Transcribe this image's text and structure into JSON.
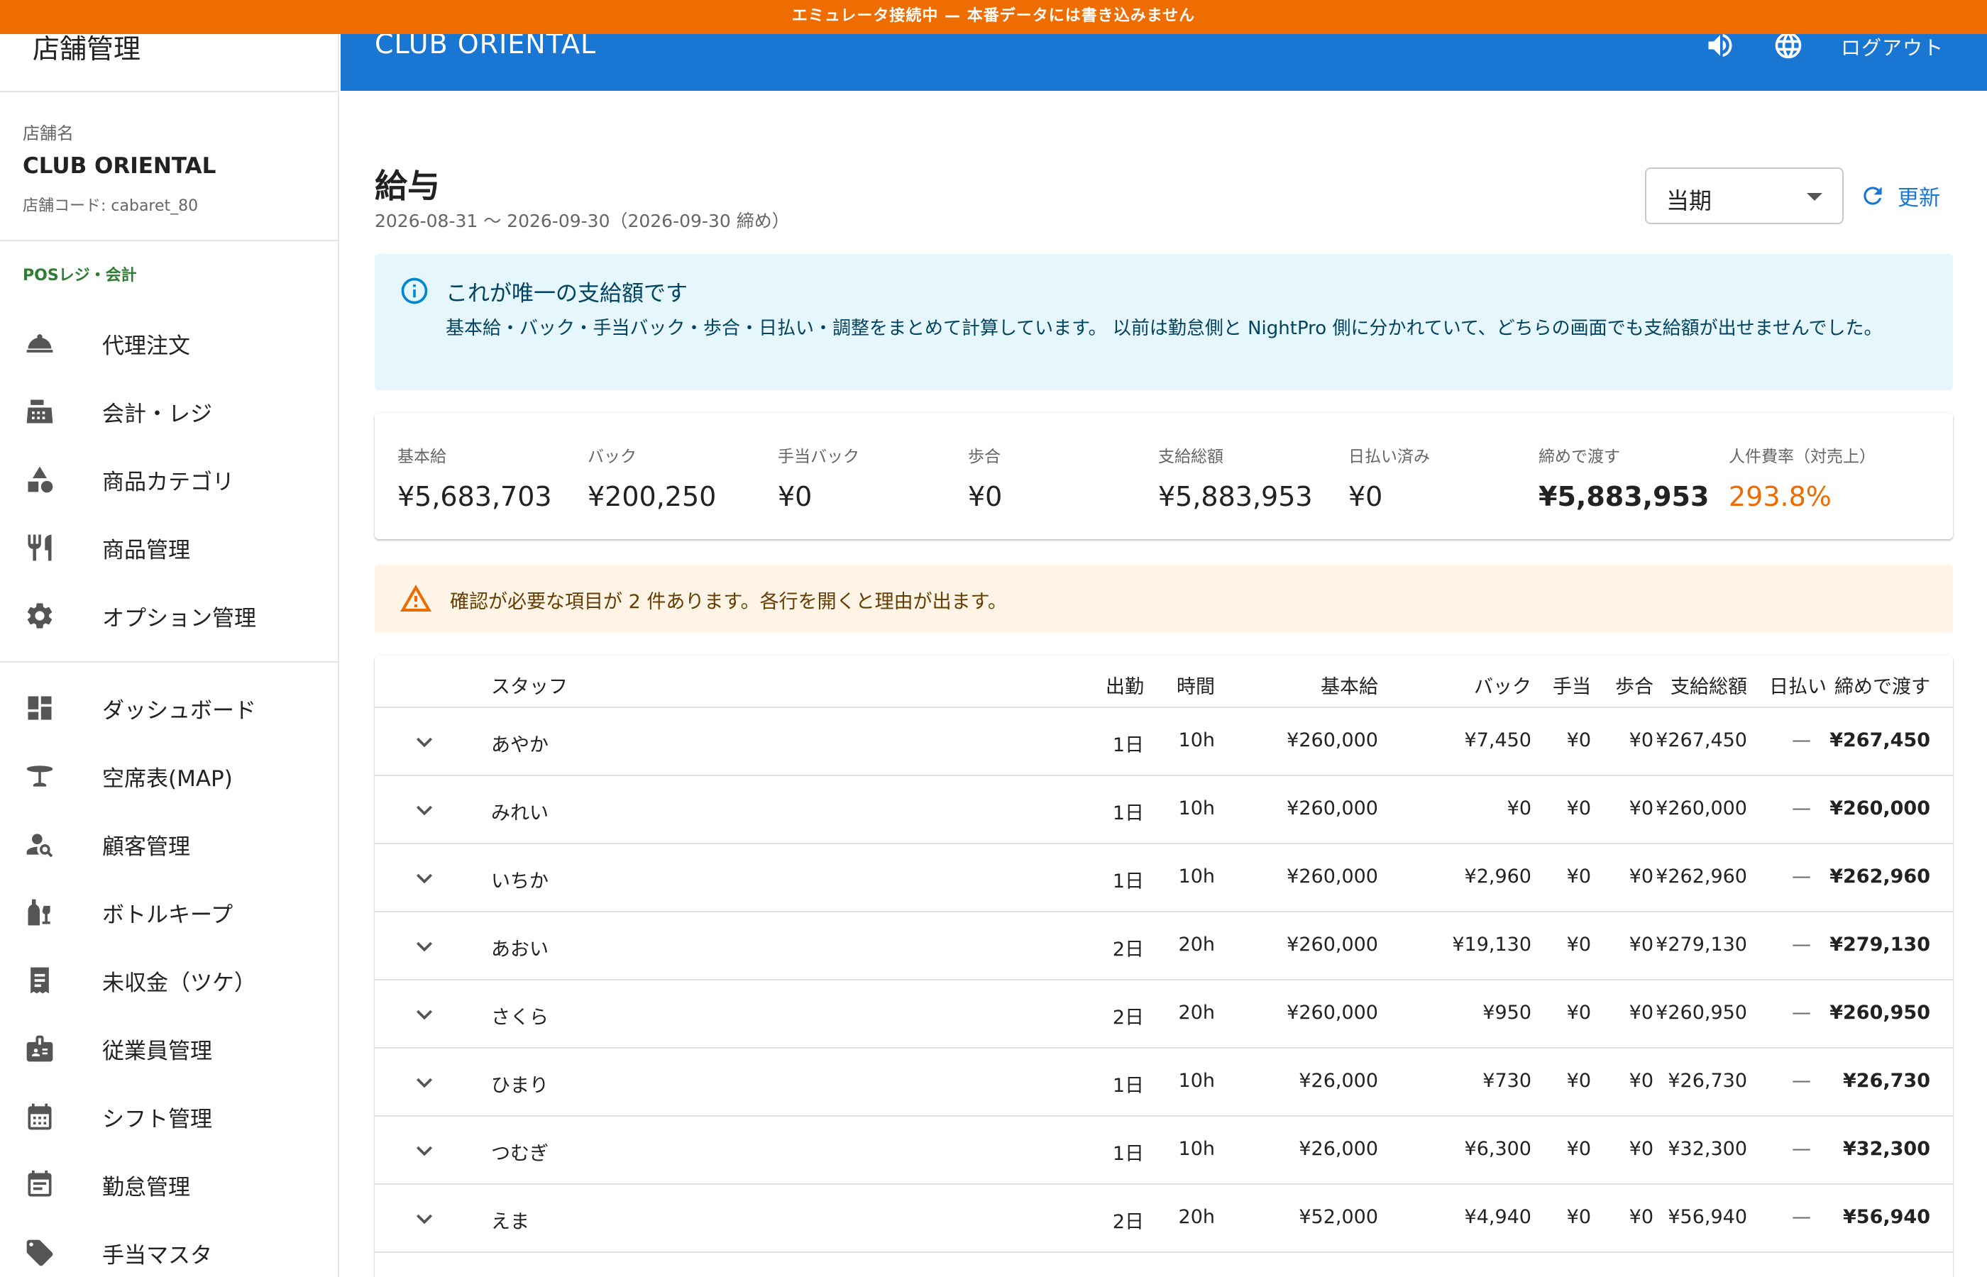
{
  "banner": "エミュレータ接続中 — 本番データには書き込みません",
  "sidebar": {
    "title": "店舗管理",
    "shop_label": "店舗名",
    "shop_name": "CLUB ORIENTAL",
    "shop_code": "店舗コード: cabaret_80",
    "section_pos": "POSレジ・会計",
    "items": [
      {
        "label": "代理注文",
        "icon": "room-service-icon"
      },
      {
        "label": "会計・レジ",
        "icon": "cash-register-icon"
      },
      {
        "label": "商品カテゴリ",
        "icon": "category-icon"
      },
      {
        "label": "商品管理",
        "icon": "restaurant-icon"
      },
      {
        "label": "オプション管理",
        "icon": "gear-icon"
      },
      {
        "label": "ダッシュボード",
        "icon": "dashboard-icon"
      },
      {
        "label": "空席表(MAP)",
        "icon": "table-icon"
      },
      {
        "label": "顧客管理",
        "icon": "person-search-icon"
      },
      {
        "label": "ボトルキープ",
        "icon": "bottle-icon"
      },
      {
        "label": "未収金（ツケ）",
        "icon": "receipt-icon"
      },
      {
        "label": "従業員管理",
        "icon": "badge-icon"
      },
      {
        "label": "シフト管理",
        "icon": "calendar-month-icon"
      },
      {
        "label": "勤怠管理",
        "icon": "event-note-icon"
      },
      {
        "label": "手当マスタ",
        "icon": "tag-icon"
      }
    ]
  },
  "appbar": {
    "title": "CLUB ORIENTAL",
    "logout": "ログアウト"
  },
  "page": {
    "title": "給与",
    "range": "2026-08-31 〜 2026-09-30（2026-09-30 締め）",
    "period_select": "当期",
    "refresh": "更新"
  },
  "info": {
    "title": "これが唯一の支給額です",
    "body": "基本給・バック・手当バック・歩合・日払い・調整をまとめて計算しています。 以前は勤怠側と NightPro 側に分かれていて、どちらの画面でも支給額が出せませんでした。"
  },
  "summary": {
    "base_label": "基本給",
    "base_value": "¥5,683,703",
    "back_label": "バック",
    "back_value": "¥200,250",
    "allow_back_label": "手当バック",
    "allow_back_value": "¥0",
    "commission_label": "歩合",
    "commission_value": "¥0",
    "total_label": "支給総額",
    "total_value": "¥5,883,953",
    "daily_label": "日払い済み",
    "daily_value": "¥0",
    "net_label": "締めで渡す",
    "net_value": "¥5,883,953",
    "ratio_label": "人件費率（対売上）",
    "ratio_value": "293.8%",
    "ratio_color": "#ed6c02"
  },
  "warning": {
    "text": "確認が必要な項目が 2 件あります。各行を開くと理由が出ます。"
  },
  "table": {
    "headers": {
      "staff": "スタッフ",
      "days": "出勤",
      "hours": "時間",
      "base": "基本給",
      "back": "バック",
      "allowance": "手当",
      "commission": "歩合",
      "total": "支給総額",
      "daily": "日払い",
      "net": "締めで渡す"
    },
    "rows": [
      {
        "staff": "あやか",
        "days": "1日",
        "hours": "10h",
        "base": "¥260,000",
        "back": "¥7,450",
        "allowance": "¥0",
        "commission": "¥0",
        "total": "¥267,450",
        "daily": "—",
        "net": "¥267,450"
      },
      {
        "staff": "みれい",
        "days": "1日",
        "hours": "10h",
        "base": "¥260,000",
        "back": "¥0",
        "allowance": "¥0",
        "commission": "¥0",
        "total": "¥260,000",
        "daily": "—",
        "net": "¥260,000"
      },
      {
        "staff": "いちか",
        "days": "1日",
        "hours": "10h",
        "base": "¥260,000",
        "back": "¥2,960",
        "allowance": "¥0",
        "commission": "¥0",
        "total": "¥262,960",
        "daily": "—",
        "net": "¥262,960"
      },
      {
        "staff": "あおい",
        "days": "2日",
        "hours": "20h",
        "base": "¥260,000",
        "back": "¥19,130",
        "allowance": "¥0",
        "commission": "¥0",
        "total": "¥279,130",
        "daily": "—",
        "net": "¥279,130"
      },
      {
        "staff": "さくら",
        "days": "2日",
        "hours": "20h",
        "base": "¥260,000",
        "back": "¥950",
        "allowance": "¥0",
        "commission": "¥0",
        "total": "¥260,950",
        "daily": "—",
        "net": "¥260,950"
      },
      {
        "staff": "ひまり",
        "days": "1日",
        "hours": "10h",
        "base": "¥26,000",
        "back": "¥730",
        "allowance": "¥0",
        "commission": "¥0",
        "total": "¥26,730",
        "daily": "—",
        "net": "¥26,730"
      },
      {
        "staff": "つむぎ",
        "days": "1日",
        "hours": "10h",
        "base": "¥26,000",
        "back": "¥6,300",
        "allowance": "¥0",
        "commission": "¥0",
        "total": "¥32,300",
        "daily": "—",
        "net": "¥32,300"
      },
      {
        "staff": "えま",
        "days": "2日",
        "hours": "20h",
        "base": "¥52,000",
        "back": "¥4,940",
        "allowance": "¥0",
        "commission": "¥0",
        "total": "¥56,940",
        "daily": "—",
        "net": "¥56,940"
      }
    ]
  }
}
